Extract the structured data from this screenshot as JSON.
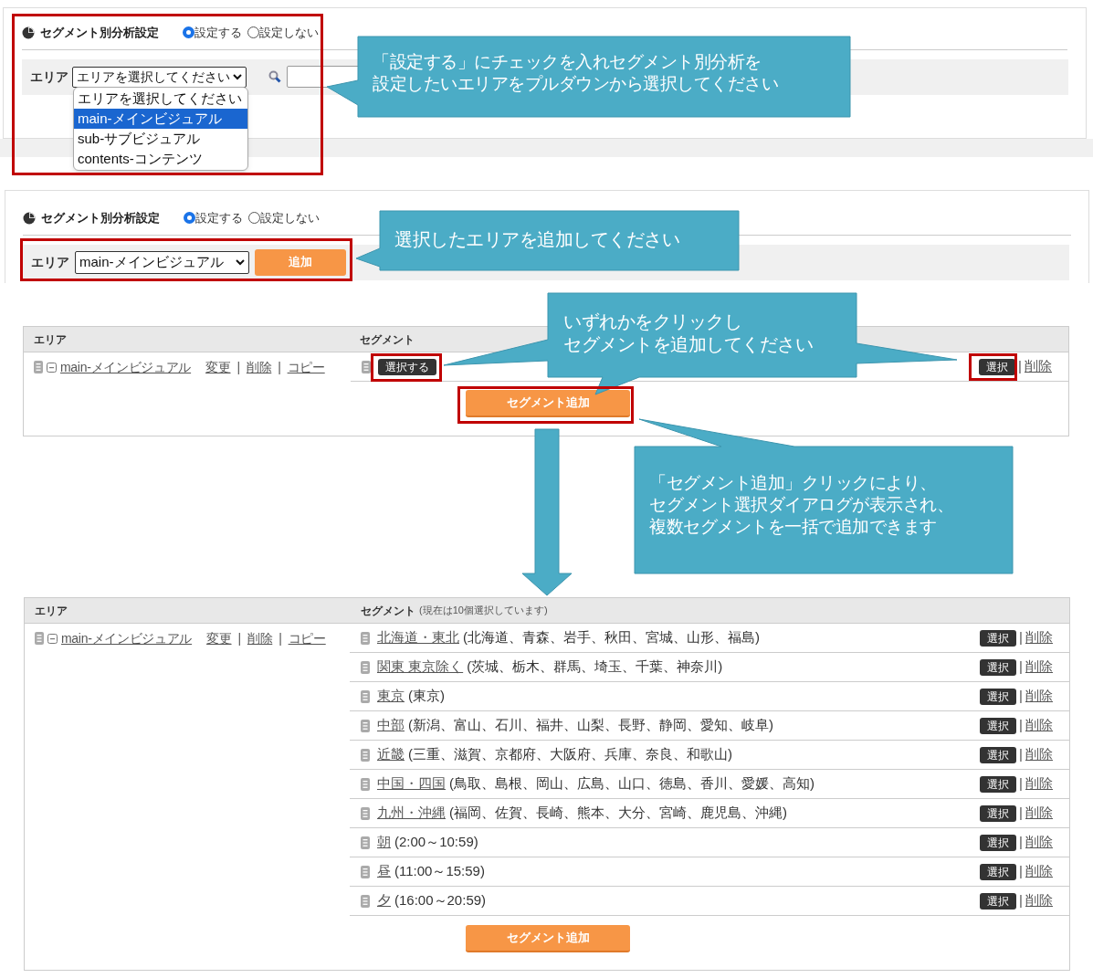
{
  "panel_setup": {
    "title": "セグメント別分析設定",
    "radios": [
      {
        "label": "設定する",
        "selected": true
      },
      {
        "label": "設定しない",
        "selected": false
      }
    ],
    "area_label": "エリア",
    "select_value": "エリアを選択してください",
    "dropdown_options": [
      {
        "label": "エリアを選択してください",
        "selected": false
      },
      {
        "label": "main-メインビジュアル",
        "selected": true
      },
      {
        "label": "sub-サブビジュアル",
        "selected": false
      },
      {
        "label": "contents-コンテンツ",
        "selected": false
      }
    ]
  },
  "panel_add": {
    "title": "セグメント別分析設定",
    "radios": [
      {
        "label": "設定する",
        "selected": true
      },
      {
        "label": "設定しない",
        "selected": false
      }
    ],
    "area_label": "エリア",
    "select_value": "main-メインビジュアル",
    "add_button": "追加"
  },
  "table_before": {
    "columns": [
      "エリア",
      "セグメント"
    ],
    "area_name": "main-メインビジュアル",
    "area_actions": [
      "変更",
      "削除",
      "コピー"
    ],
    "separator": "|",
    "select_all_button": "選択する",
    "select_button": "選択",
    "delete_link": "削除",
    "add_button": "セグメント追加"
  },
  "table_after": {
    "columns": [
      "エリア",
      "セグメント"
    ],
    "column_note": "(現在は10個選択しています)",
    "area_name": "main-メインビジュアル",
    "area_actions": [
      "変更",
      "削除",
      "コピー"
    ],
    "separator": "|",
    "segments": [
      {
        "name": "北海道・東北",
        "detail": "(北海道、青森、岩手、秋田、宮城、山形、福島)",
        "select": "選択",
        "delete": "削除"
      },
      {
        "name": "関東 東京除く",
        "detail": "(茨城、栃木、群馬、埼玉、千葉、神奈川)",
        "select": "選択",
        "delete": "削除"
      },
      {
        "name": "東京",
        "detail": "(東京)",
        "select": "選択",
        "delete": "削除"
      },
      {
        "name": "中部",
        "detail": "(新潟、富山、石川、福井、山梨、長野、静岡、愛知、岐阜)",
        "select": "選択",
        "delete": "削除"
      },
      {
        "name": "近畿",
        "detail": "(三重、滋賀、京都府、大阪府、兵庫、奈良、和歌山)",
        "select": "選択",
        "delete": "削除"
      },
      {
        "name": "中国・四国",
        "detail": "(鳥取、島根、岡山、広島、山口、徳島、香川、愛媛、高知)",
        "select": "選択",
        "delete": "削除"
      },
      {
        "name": "九州・沖縄",
        "detail": "(福岡、佐賀、長崎、熊本、大分、宮崎、鹿児島、沖縄)",
        "select": "選択",
        "delete": "削除"
      },
      {
        "name": "朝",
        "detail": "(2:00～10:59)",
        "select": "選択",
        "delete": "削除"
      },
      {
        "name": "昼",
        "detail": "(11:00～15:59)",
        "select": "選択",
        "delete": "削除"
      },
      {
        "name": "夕",
        "detail": "(16:00～20:59)",
        "select": "選択",
        "delete": "削除"
      }
    ],
    "add_button": "セグメント追加"
  },
  "callouts": [
    {
      "lines": [
        "「設定する」にチェックを入れセグメント別分析を",
        "設定したいエリアをプルダウンから選択してください"
      ]
    },
    {
      "lines": [
        "選択したエリアを追加してください"
      ]
    },
    {
      "lines": [
        "いずれかをクリックし",
        "セグメントを追加してください"
      ]
    },
    {
      "lines": [
        "「セグメント追加」クリックにより、",
        "セグメント選択ダイアログが表示され、",
        "複数セグメントを一括で追加できます"
      ]
    }
  ]
}
